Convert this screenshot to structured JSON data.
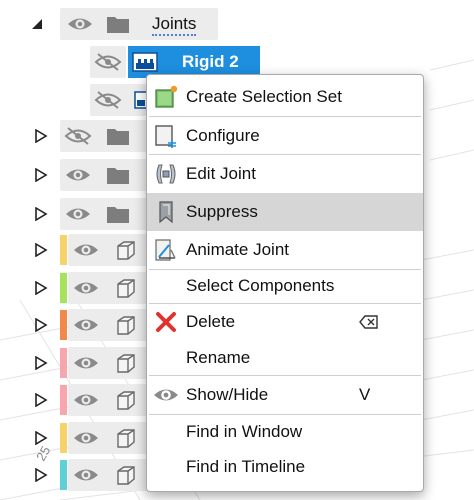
{
  "tree": {
    "joints_row": {
      "label": "Joints"
    },
    "selected_row": {
      "label": "Rigid 2"
    },
    "band_rows": [
      "row-1",
      "row-2",
      "row-3"
    ],
    "component_rows": [
      {
        "color": "#f5d36a"
      },
      {
        "color": "#a6e25c"
      },
      {
        "color": "#f08a4b"
      },
      {
        "color": "#f7a6ae"
      },
      {
        "color": "#f7a6ae"
      },
      {
        "color": "#f5d36a"
      },
      {
        "color": "#5fd1d6"
      }
    ],
    "canvas_number": "25"
  },
  "context_menu": {
    "items": [
      {
        "label": "Create Selection Set",
        "icon": "create-selection-set-icon"
      },
      {
        "label": "Configure",
        "icon": "configure-icon"
      },
      {
        "label": "Edit Joint",
        "icon": "edit-joint-icon"
      },
      {
        "label": "Suppress",
        "icon": "suppress-icon",
        "highlighted": true
      },
      {
        "label": "Animate Joint",
        "icon": "animate-joint-icon"
      },
      {
        "label": "Select Components"
      },
      {
        "label": "Delete",
        "icon": "delete-icon",
        "shortcut_icon": "delete-key-icon"
      },
      {
        "label": "Rename"
      },
      {
        "label": "Show/Hide",
        "icon": "eye-icon",
        "shortcut": "V"
      },
      {
        "label": "Find in Window"
      },
      {
        "label": "Find in Timeline"
      }
    ]
  },
  "colors": {
    "selection": "#1e8fde",
    "highlight": "#d6d6d6",
    "delete_red": "#e0332f"
  }
}
